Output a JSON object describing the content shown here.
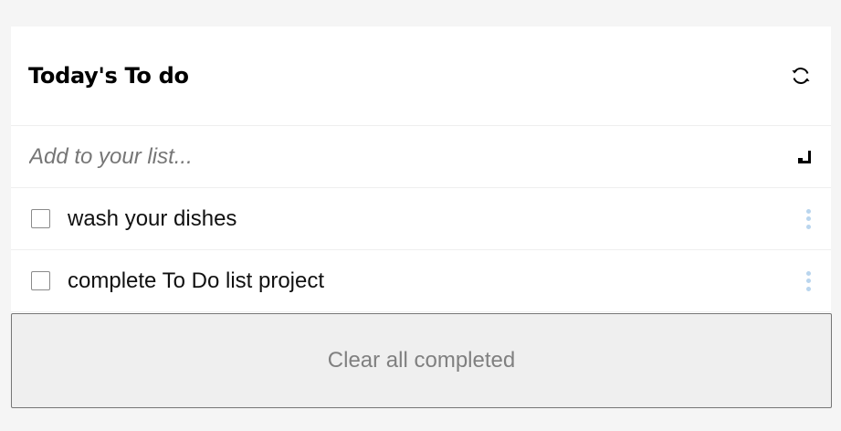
{
  "header": {
    "title": "Today's To do",
    "refresh_icon": "refresh-icon"
  },
  "add": {
    "placeholder": "Add to your list...",
    "enter_icon": "enter-return-icon"
  },
  "todos": [
    {
      "text": "wash your dishes",
      "checked": false
    },
    {
      "text": "complete To Do list project",
      "checked": false
    }
  ],
  "footer": {
    "clear_label": "Clear all completed"
  },
  "colors": {
    "background": "#f5f5f5",
    "card": "#ffffff",
    "kebab": "#b9d5ee",
    "button_bg": "#efefef",
    "button_text": "#808080"
  }
}
